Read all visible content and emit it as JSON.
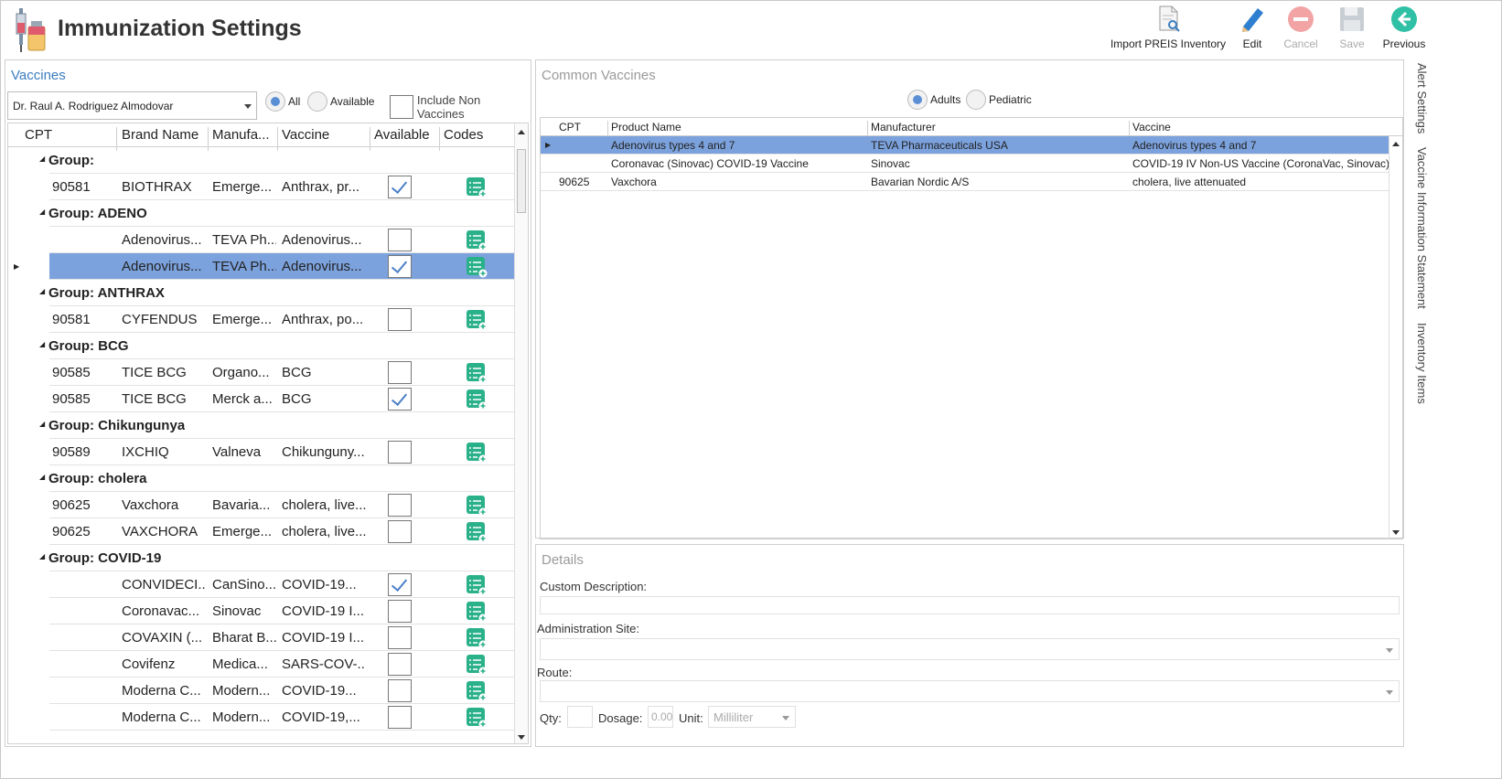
{
  "window": {
    "title": "Immunization Settings"
  },
  "toolbar": {
    "import": "Import PREIS Inventory",
    "edit": "Edit",
    "cancel": "Cancel",
    "save": "Save",
    "previous": "Previous"
  },
  "vaccines": {
    "title": "Vaccines",
    "provider": "Dr. Raul A. Rodriguez Almodovar",
    "filter_all": "All",
    "filter_available": "Available",
    "include_non": "Include Non Vaccines",
    "selected_filter": "All",
    "columns": [
      "CPT",
      "Brand Name",
      "Manufa...",
      "Vaccine",
      "Available",
      "Codes"
    ],
    "rows": [
      {
        "type": "group",
        "label": "Group:"
      },
      {
        "cpt": "90581",
        "brand": "BIOTHRAX",
        "mfr": "Emerge...",
        "vaccine": "Anthrax, pr...",
        "available": true
      },
      {
        "type": "group",
        "label": "Group: ADENO"
      },
      {
        "cpt": "",
        "brand": "Adenovirus...",
        "mfr": "TEVA Ph...",
        "vaccine": "Adenovirus...",
        "available": false
      },
      {
        "cpt": "",
        "brand": "Adenovirus...",
        "mfr": "TEVA Ph...",
        "vaccine": "Adenovirus...",
        "available": true,
        "selected": true
      },
      {
        "type": "group",
        "label": "Group: ANTHRAX"
      },
      {
        "cpt": "90581",
        "brand": "CYFENDUS",
        "mfr": "Emerge...",
        "vaccine": "Anthrax, po...",
        "available": false
      },
      {
        "type": "group",
        "label": "Group: BCG"
      },
      {
        "cpt": "90585",
        "brand": "TICE BCG",
        "mfr": "Organo...",
        "vaccine": "BCG",
        "available": false
      },
      {
        "cpt": "90585",
        "brand": "TICE BCG",
        "mfr": "Merck a...",
        "vaccine": "BCG",
        "available": true
      },
      {
        "type": "group",
        "label": "Group: Chikungunya"
      },
      {
        "cpt": "90589",
        "brand": "IXCHIQ",
        "mfr": "Valneva",
        "vaccine": "Chikunguny...",
        "available": false
      },
      {
        "type": "group",
        "label": "Group: cholera"
      },
      {
        "cpt": "90625",
        "brand": "Vaxchora",
        "mfr": "Bavaria...",
        "vaccine": "cholera, live...",
        "available": false
      },
      {
        "cpt": "90625",
        "brand": "VAXCHORA",
        "mfr": "Emerge...",
        "vaccine": "cholera, live...",
        "available": false
      },
      {
        "type": "group",
        "label": "Group: COVID-19"
      },
      {
        "cpt": "",
        "brand": "CONVIDECI...",
        "mfr": "CanSino...",
        "vaccine": "COVID-19...",
        "available": true
      },
      {
        "cpt": "",
        "brand": "Coronavac...",
        "mfr": "Sinovac",
        "vaccine": "COVID-19 I...",
        "available": false
      },
      {
        "cpt": "",
        "brand": "COVAXIN (...",
        "mfr": "Bharat B...",
        "vaccine": "COVID-19 I...",
        "available": false
      },
      {
        "cpt": "",
        "brand": "Covifenz",
        "mfr": "Medica...",
        "vaccine": "SARS-COV-...",
        "available": false
      },
      {
        "cpt": "",
        "brand": "Moderna C...",
        "mfr": "Modern...",
        "vaccine": "COVID-19...",
        "available": false
      },
      {
        "cpt": "",
        "brand": "Moderna C...",
        "mfr": "Modern...",
        "vaccine": "COVID-19,...",
        "available": false
      }
    ]
  },
  "common": {
    "title": "Common Vaccines",
    "adults": "Adults",
    "pediatric": "Pediatric",
    "selected": "Adults",
    "columns": [
      "CPT",
      "Product Name",
      "Manufacturer",
      "Vaccine"
    ],
    "rows": [
      {
        "cpt": "",
        "product": "Adenovirus types 4 and 7",
        "mfr": "TEVA Pharmaceuticals USA",
        "vaccine": "Adenovirus types 4 and 7",
        "selected": true
      },
      {
        "cpt": "",
        "product": "Coronavac (Sinovac) COVID-19 Vaccine",
        "mfr": "Sinovac",
        "vaccine": "COVID-19 IV Non-US Vaccine (CoronaVac, Sinovac)"
      },
      {
        "cpt": "90625",
        "product": "Vaxchora",
        "mfr": "Bavarian Nordic A/S",
        "vaccine": "cholera, live attenuated"
      }
    ]
  },
  "details": {
    "title": "Details",
    "custom_desc": "Custom Description:",
    "admin_site": "Administration Site:",
    "route": "Route:",
    "qty": "Qty:",
    "dosage": "Dosage:",
    "dosage_value": "0.00",
    "unit": "Unit:",
    "unit_value": "Milliliter"
  },
  "side_tabs": [
    "Alert Settings",
    "Vaccine Information Statement",
    "Inventory Items"
  ],
  "colors": {
    "accent": "#3a7dc0",
    "selection": "#7ca2dd",
    "codes_icon": "#2bb18a"
  }
}
